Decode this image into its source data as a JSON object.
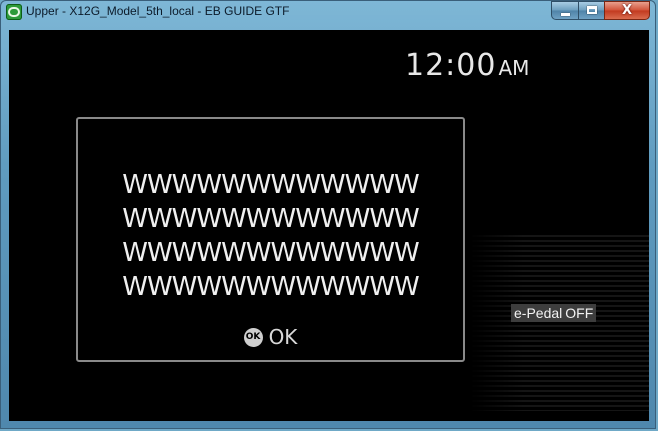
{
  "window": {
    "title": "Upper - X12G_Model_5th_local - EB GUIDE GTF",
    "icon": "eb-guide-app-icon",
    "controls": {
      "minimize_icon": "minimize-icon",
      "maximize_icon": "maximize-icon",
      "close_glyph": "X"
    }
  },
  "display": {
    "clock": {
      "time": "12:00",
      "ampm": "AM"
    },
    "dialog": {
      "lines": [
        "WWWWWWWWWWWW",
        "WWWWWWWWWWWW",
        "WWWWWWWWWWWW",
        "WWWWWWWWWWWW"
      ],
      "ok_icon_text": "OK",
      "ok_label": "OK"
    },
    "epedal": {
      "label": "e-Pedal",
      "state": "OFF"
    }
  },
  "colors": {
    "screen_background": "#000000",
    "dialog_border": "#8a8a8a",
    "text": "#f0f0f0",
    "badge_background": "#3d3d3d",
    "close_button": "#c23a1f"
  }
}
